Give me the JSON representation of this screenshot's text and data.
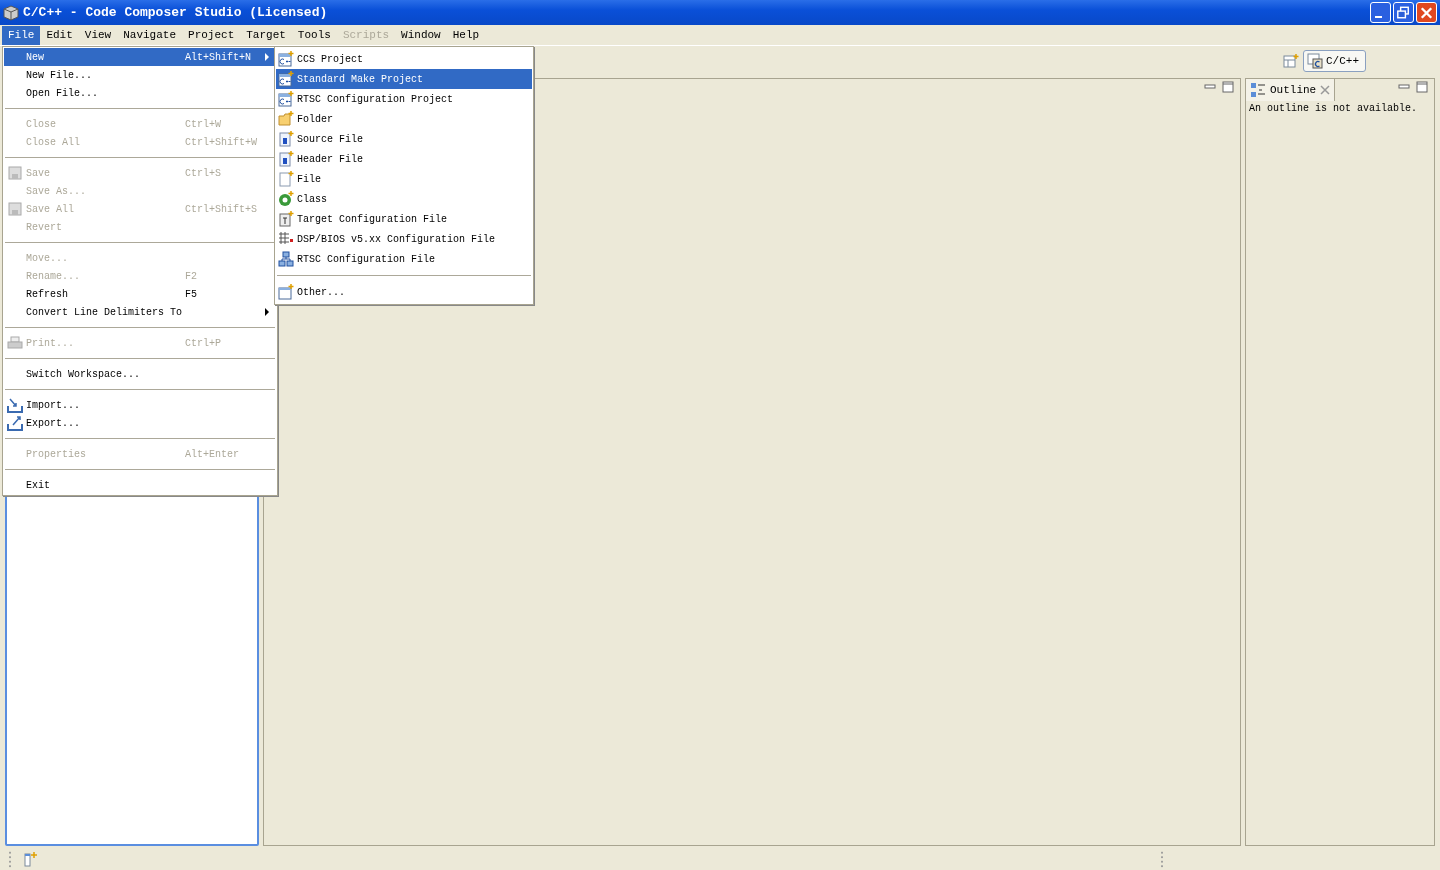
{
  "window": {
    "title": "C/C++ - Code Composer Studio (Licensed)"
  },
  "menubar": [
    {
      "label": "File",
      "selected": true,
      "disabled": false
    },
    {
      "label": "Edit",
      "selected": false,
      "disabled": false
    },
    {
      "label": "View",
      "selected": false,
      "disabled": false
    },
    {
      "label": "Navigate",
      "selected": false,
      "disabled": false
    },
    {
      "label": "Project",
      "selected": false,
      "disabled": false
    },
    {
      "label": "Target",
      "selected": false,
      "disabled": false
    },
    {
      "label": "Tools",
      "selected": false,
      "disabled": false
    },
    {
      "label": "Scripts",
      "selected": false,
      "disabled": true
    },
    {
      "label": "Window",
      "selected": false,
      "disabled": false
    },
    {
      "label": "Help",
      "selected": false,
      "disabled": false
    }
  ],
  "perspective": {
    "label": "C/C++"
  },
  "file_menu": [
    {
      "kind": "item",
      "label": "New",
      "shortcut": "Alt+Shift+N",
      "disabled": false,
      "selected": true,
      "submenu": true
    },
    {
      "kind": "item",
      "label": "New File...",
      "disabled": false,
      "selected": false,
      "submenu": false
    },
    {
      "kind": "item",
      "label": "Open File...",
      "disabled": false,
      "selected": false,
      "submenu": false
    },
    {
      "kind": "separator"
    },
    {
      "kind": "item",
      "label": "Close",
      "shortcut": "Ctrl+W",
      "disabled": true,
      "selected": false,
      "submenu": false
    },
    {
      "kind": "item",
      "label": "Close All",
      "shortcut": "Ctrl+Shift+W",
      "disabled": true,
      "selected": false,
      "submenu": false
    },
    {
      "kind": "separator"
    },
    {
      "kind": "item",
      "label": "Save",
      "shortcut": "Ctrl+S",
      "disabled": true,
      "selected": false,
      "submenu": false
    },
    {
      "kind": "item",
      "label": "Save As...",
      "disabled": true,
      "selected": false,
      "submenu": false
    },
    {
      "kind": "item",
      "label": "Save All",
      "shortcut": "Ctrl+Shift+S",
      "disabled": true,
      "selected": false,
      "submenu": false
    },
    {
      "kind": "item",
      "label": "Revert",
      "disabled": true,
      "selected": false,
      "submenu": false
    },
    {
      "kind": "separator"
    },
    {
      "kind": "item",
      "label": "Move...",
      "disabled": true,
      "selected": false,
      "submenu": false
    },
    {
      "kind": "item",
      "label": "Rename...",
      "shortcut": "F2",
      "disabled": true,
      "selected": false,
      "submenu": false
    },
    {
      "kind": "item",
      "label": "Refresh",
      "shortcut": "F5",
      "disabled": false,
      "selected": false,
      "submenu": false
    },
    {
      "kind": "item",
      "label": "Convert Line Delimiters To",
      "disabled": false,
      "selected": false,
      "submenu": true
    },
    {
      "kind": "separator"
    },
    {
      "kind": "item",
      "label": "Print...",
      "shortcut": "Ctrl+P",
      "disabled": true,
      "selected": false,
      "submenu": false
    },
    {
      "kind": "separator"
    },
    {
      "kind": "item",
      "label": "Switch Workspace...",
      "disabled": false,
      "selected": false,
      "submenu": false
    },
    {
      "kind": "separator"
    },
    {
      "kind": "item",
      "label": "Import...",
      "disabled": false,
      "selected": false,
      "submenu": false
    },
    {
      "kind": "item",
      "label": "Export...",
      "disabled": false,
      "selected": false,
      "submenu": false
    },
    {
      "kind": "separator"
    },
    {
      "kind": "item",
      "label": "Properties",
      "shortcut": "Alt+Enter",
      "disabled": true,
      "selected": false,
      "submenu": false
    },
    {
      "kind": "separator"
    },
    {
      "kind": "item",
      "label": "Exit",
      "disabled": false,
      "selected": false,
      "submenu": false
    }
  ],
  "new_submenu": [
    {
      "kind": "item",
      "label": "CCS Project",
      "selected": false
    },
    {
      "kind": "item",
      "label": "Standard Make Project",
      "selected": true
    },
    {
      "kind": "item",
      "label": "RTSC Configuration Project",
      "selected": false
    },
    {
      "kind": "item",
      "label": "Folder",
      "selected": false
    },
    {
      "kind": "item",
      "label": "Source File",
      "selected": false
    },
    {
      "kind": "item",
      "label": "Header File",
      "selected": false
    },
    {
      "kind": "item",
      "label": "File",
      "selected": false
    },
    {
      "kind": "item",
      "label": "Class",
      "selected": false
    },
    {
      "kind": "item",
      "label": "Target Configuration File",
      "selected": false
    },
    {
      "kind": "item",
      "label": "DSP/BIOS v5.xx Configuration File",
      "selected": false
    },
    {
      "kind": "item",
      "label": "RTSC Configuration File",
      "selected": false
    },
    {
      "kind": "separator"
    },
    {
      "kind": "item",
      "label": "Other...",
      "selected": false
    }
  ],
  "outline_view": {
    "tab": "Outline",
    "message": "An outline is not available."
  }
}
